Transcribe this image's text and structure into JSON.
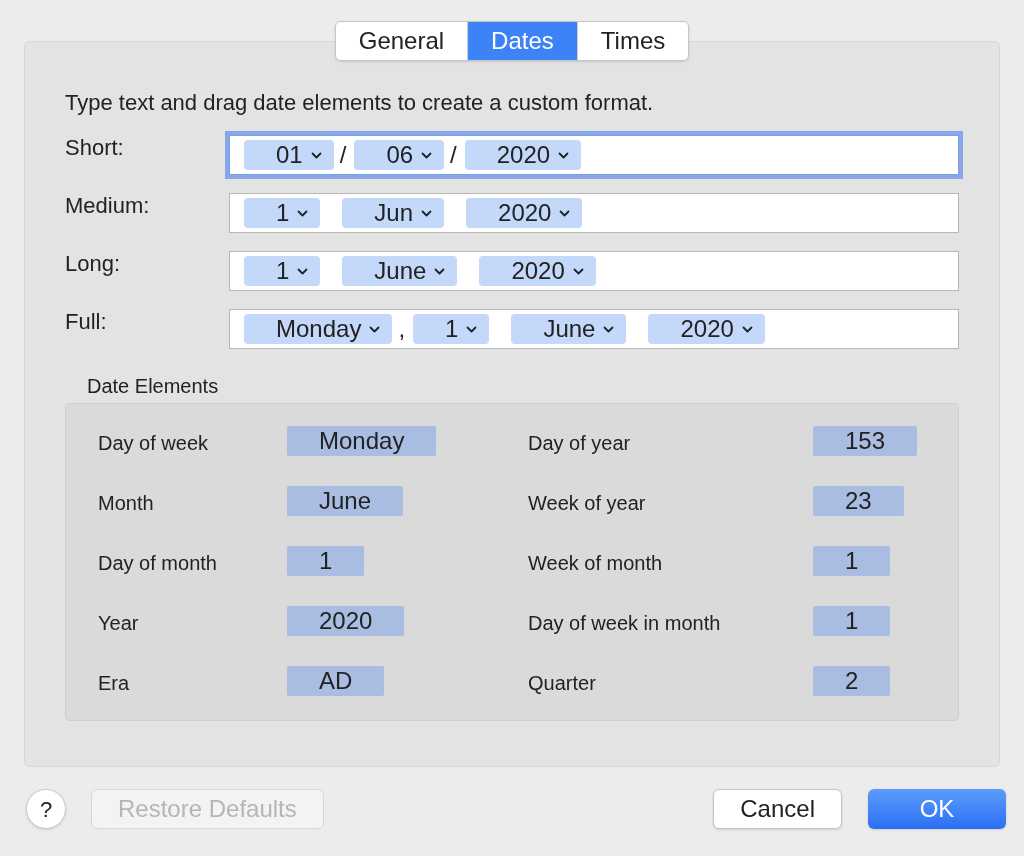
{
  "tabs": [
    {
      "label": "General",
      "selected": false
    },
    {
      "label": "Dates",
      "selected": true
    },
    {
      "label": "Times",
      "selected": false
    }
  ],
  "instructions": "Type text and drag date elements to create a custom format.",
  "formats": [
    {
      "label": "Short:",
      "focused": true,
      "parts": [
        {
          "kind": "token",
          "text": "01"
        },
        {
          "kind": "separator",
          "text": "/"
        },
        {
          "kind": "token",
          "text": "06"
        },
        {
          "kind": "separator",
          "text": "/"
        },
        {
          "kind": "token",
          "text": "2020"
        }
      ]
    },
    {
      "label": "Medium:",
      "focused": false,
      "parts": [
        {
          "kind": "token",
          "text": "1"
        },
        {
          "kind": "token",
          "text": "Jun"
        },
        {
          "kind": "token",
          "text": "2020"
        }
      ]
    },
    {
      "label": "Long:",
      "focused": false,
      "parts": [
        {
          "kind": "token",
          "text": "1"
        },
        {
          "kind": "token",
          "text": "June"
        },
        {
          "kind": "token",
          "text": "2020"
        }
      ]
    },
    {
      "label": "Full:",
      "focused": false,
      "parts": [
        {
          "kind": "token",
          "text": "Monday"
        },
        {
          "kind": "separator",
          "text": ","
        },
        {
          "kind": "token",
          "text": "1"
        },
        {
          "kind": "token",
          "text": "June"
        },
        {
          "kind": "token",
          "text": "2020"
        }
      ]
    }
  ],
  "date_elements": {
    "title": "Date Elements",
    "items": [
      {
        "label": "Day of week",
        "value": "Monday"
      },
      {
        "label": "Day of year",
        "value": "153"
      },
      {
        "label": "Month",
        "value": "June"
      },
      {
        "label": "Week of year",
        "value": "23"
      },
      {
        "label": "Day of month",
        "value": "1"
      },
      {
        "label": "Week of month",
        "value": "1"
      },
      {
        "label": "Year",
        "value": "2020"
      },
      {
        "label": "Day of week in month",
        "value": "1"
      },
      {
        "label": "Era",
        "value": "AD"
      },
      {
        "label": "Quarter",
        "value": "2"
      }
    ]
  },
  "buttons": [
    {
      "kind": "help",
      "label": "?"
    },
    {
      "kind": "secondary",
      "label": "Restore Defaults",
      "disabled": true
    },
    {
      "kind": "secondary",
      "label": "Cancel",
      "disabled": false
    },
    {
      "kind": "primary",
      "label": "OK"
    }
  ]
}
